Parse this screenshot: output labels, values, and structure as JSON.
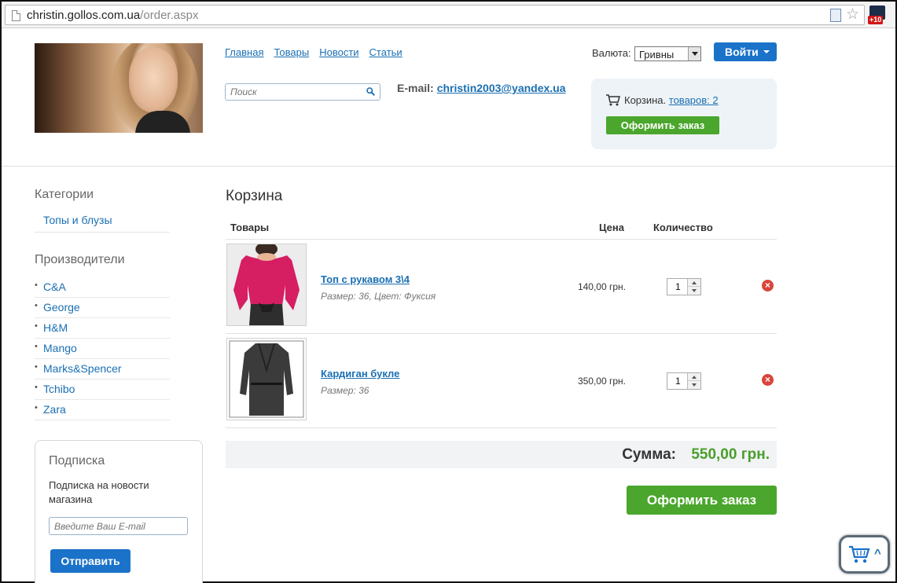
{
  "browser": {
    "url_host": "christin.gollos.com.ua",
    "url_path": "/order.aspx",
    "ext_badge": "+10"
  },
  "header": {
    "nav": [
      "Главная",
      "Товары",
      "Новости",
      "Статьи"
    ],
    "search_placeholder": "Поиск",
    "email_label": "E-mail:",
    "email_value": "christin2003@yandex.ua",
    "currency_label": "Валюта:",
    "currency_value": "Гривны",
    "login_label": "Войти",
    "cart_label": "Корзина.",
    "cart_link": "товаров: 2",
    "cart_order_label": "Оформить заказ"
  },
  "sidebar": {
    "categories_title": "Категории",
    "categories": [
      "Топы и блузы"
    ],
    "brands_title": "Производители",
    "brands": [
      "C&A",
      "George",
      "H&M",
      "Mango",
      "Marks&Spencer",
      "Tchibo",
      "Zara"
    ],
    "subscribe": {
      "title": "Подписка",
      "text": "Подписка на новости магазина",
      "placeholder": "Введите Ваш E-mail",
      "button": "Отправить"
    }
  },
  "cart": {
    "title": "Корзина",
    "columns": {
      "items": "Товары",
      "price": "Цена",
      "qty": "Количество"
    },
    "items": [
      {
        "name": "Топ с рукавом 3\\4",
        "desc": "Размер: 36, Цвет: Фуксия",
        "price": "140,00 грн.",
        "qty": "1"
      },
      {
        "name": "Кардиган букле",
        "desc": "Размер: 36",
        "price": "350,00 грн.",
        "qty": "1"
      }
    ],
    "sum_label": "Сумма:",
    "sum_value": "550,00 грн.",
    "checkout_label": "Оформить заказ"
  },
  "colors": {
    "link": "#1a6fb3",
    "primary_button": "#1a72c9",
    "order_button": "#4aa62c",
    "sum_value": "#4a9e2b",
    "remove": "#d9453b"
  },
  "icons": [
    "page-icon",
    "document-icon",
    "star-icon",
    "extension-icon",
    "search-icon",
    "cart-icon",
    "remove-icon",
    "chevron-up-icon"
  ]
}
